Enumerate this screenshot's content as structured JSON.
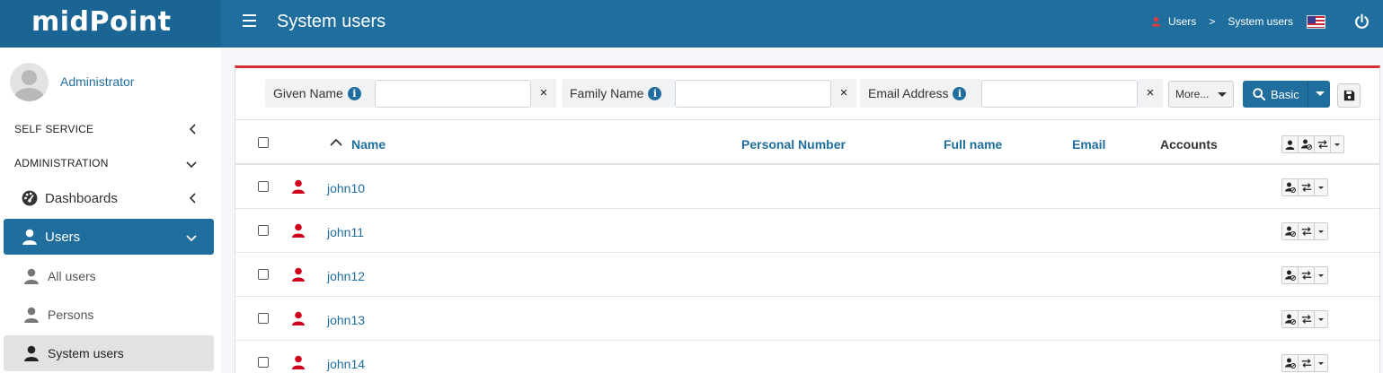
{
  "app": {
    "brand": "midPoint",
    "page_title": "System users"
  },
  "breadcrumbs": {
    "item1": "Users",
    "separator": ">",
    "item2": "System users"
  },
  "sidebar": {
    "user_name": "Administrator",
    "sections": [
      {
        "label": "SELF SERVICE"
      },
      {
        "label": "ADMINISTRATION"
      }
    ],
    "items": [
      {
        "label": "Dashboards"
      },
      {
        "label": "Users"
      },
      {
        "label": "All users"
      },
      {
        "label": "Persons"
      },
      {
        "label": "System users"
      }
    ]
  },
  "search": {
    "fields": [
      {
        "label": "Given Name",
        "value": ""
      },
      {
        "label": "Family Name",
        "value": ""
      },
      {
        "label": "Email Address",
        "value": ""
      }
    ],
    "clear_symbol": "×",
    "more_label": "More...",
    "basic_label": "Basic"
  },
  "table": {
    "columns": [
      "Name",
      "Personal Number",
      "Full name",
      "Email",
      "Accounts"
    ],
    "rows": [
      {
        "name": "john10"
      },
      {
        "name": "john11"
      },
      {
        "name": "john12"
      },
      {
        "name": "john13"
      },
      {
        "name": "john14"
      }
    ]
  },
  "colors": {
    "brand": "#1f6e9e",
    "header": "#1f6e9e",
    "panel_accent": "#d32f2f",
    "user_icon": "#d0021b"
  }
}
